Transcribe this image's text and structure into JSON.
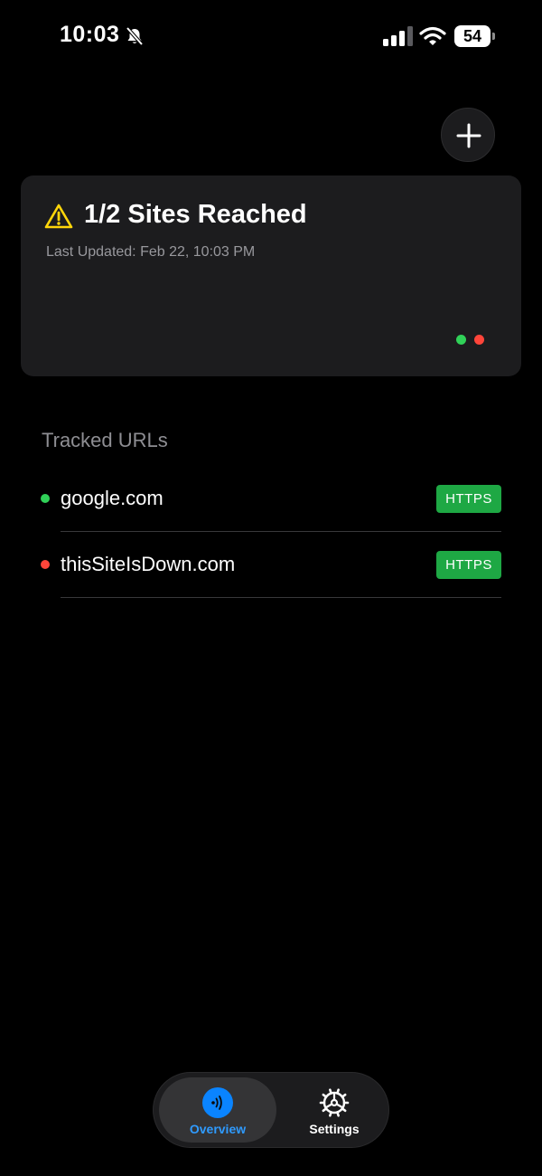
{
  "status_bar": {
    "time": "10:03",
    "battery": "54",
    "icons": [
      "bell-slash-icon",
      "cellular-signal-icon",
      "wifi-icon",
      "battery-icon"
    ]
  },
  "header": {
    "add_icon": "plus-icon"
  },
  "summary": {
    "icon": "warning-triangle-icon",
    "title": "1/2 Sites Reached",
    "last_updated": "Last Updated: Feb 22, 10:03 PM"
  },
  "tracked": {
    "title": "Tracked URLs",
    "items": [
      {
        "url": "google.com",
        "protocol": "HTTPS",
        "status": "up"
      },
      {
        "url": "thisSiteIsDown.com",
        "protocol": "HTTPS",
        "status": "down"
      }
    ]
  },
  "tabs": {
    "overview": {
      "label": "Overview",
      "icon": "radio-waves-icon"
    },
    "settings": {
      "label": "Settings",
      "icon": "gear-icon"
    }
  },
  "colors": {
    "background": "#000000",
    "card": "#1c1c1e",
    "up": "#30d158",
    "down": "#ff453a",
    "warning": "#ffd60a",
    "badge": "#1ea844",
    "accent": "#0a84ff",
    "accent_label": "#2f9bff",
    "secondary_text": "#98989d"
  }
}
